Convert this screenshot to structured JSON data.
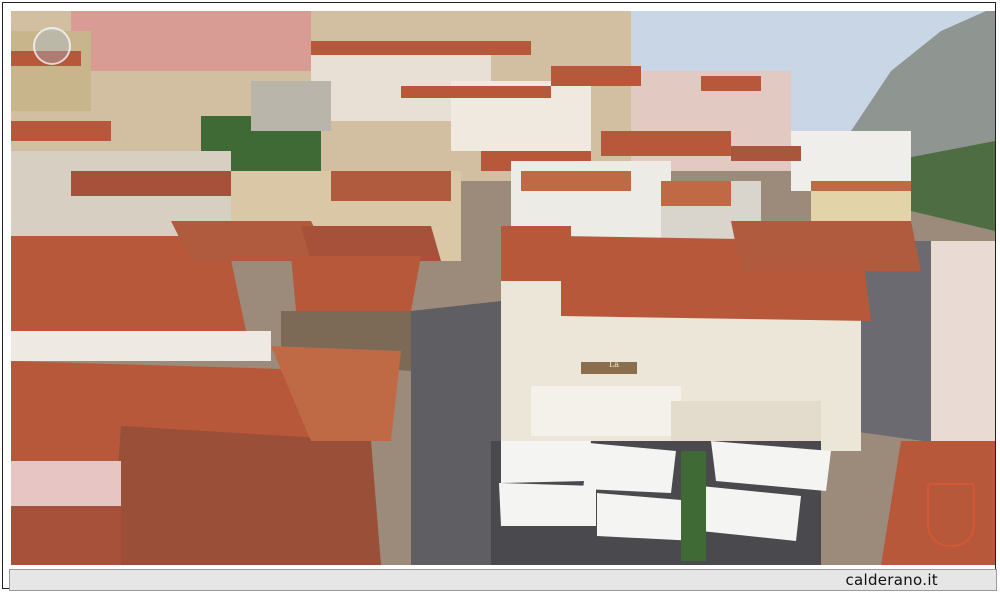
{
  "photo": {
    "subject": "aerial view of a hillside village with terracotta rooftops and a pedestrian street",
    "palette": {
      "sky": "#c9d6e6",
      "mountain": "#8f9590",
      "roof": "#b8583b",
      "roof_dark": "#8d4430",
      "wall_light": "#e9e4da",
      "wall_warm": "#d9c6a4",
      "street": "#5f5f63",
      "umbrella": "#f4f4f2",
      "greenery": "#3f6a35"
    }
  },
  "shop_sign": "La Caffetteria",
  "caption": {
    "site": "calderano.it"
  }
}
